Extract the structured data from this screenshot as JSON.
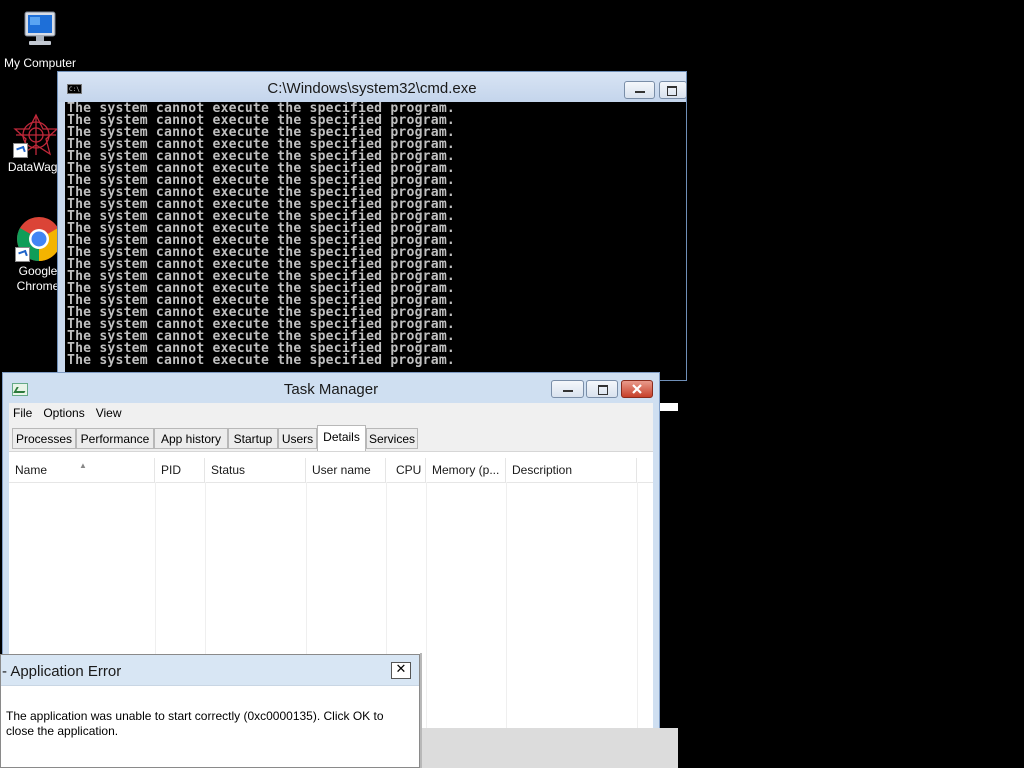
{
  "desktop": {
    "icons": [
      {
        "label": "My Computer",
        "icon": "computer-icon"
      },
      {
        "label": "DataWago",
        "icon": "datawagon-icon"
      },
      {
        "label": "Google\nChrome",
        "icon": "chrome-icon"
      }
    ]
  },
  "cmd": {
    "title": "C:\\Windows\\system32\\cmd.exe",
    "line": "The system cannot execute the specified program.",
    "line_count": 22
  },
  "task_manager": {
    "title": "Task Manager",
    "menu": [
      "File",
      "Options",
      "View"
    ],
    "tabs": [
      "Processes",
      "Performance",
      "App history",
      "Startup",
      "Users",
      "Details",
      "Services"
    ],
    "active_tab": "Details",
    "columns": [
      "Name",
      "PID",
      "Status",
      "User name",
      "CPU",
      "Memory (p...",
      "Description"
    ]
  },
  "error_dialog": {
    "title": "- Application Error",
    "close_label": "✕",
    "message": "The application was unable to start correctly (0xc0000135). Click OK to close the application."
  },
  "colors": {
    "desktop_bg": "#000000",
    "console_bg": "#000000",
    "console_text": "#c0c0c0",
    "window_frame": "#cfdff1",
    "close_red": "#c7402a"
  }
}
